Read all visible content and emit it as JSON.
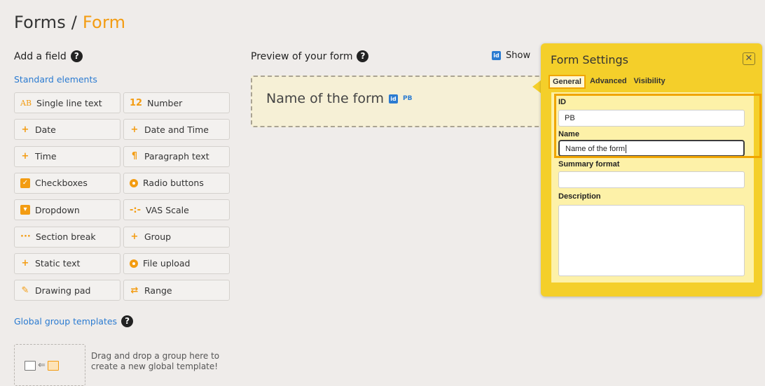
{
  "page": {
    "title_prefix": "Forms / ",
    "title_accent": "Form"
  },
  "left": {
    "add_field": "Add a field",
    "standard": "Standard elements",
    "fields": [
      {
        "label": "Single line text",
        "icon": "ab-icon",
        "glyph": "AB"
      },
      {
        "label": "Number",
        "icon": "number-icon",
        "glyph": "12"
      },
      {
        "label": "Date",
        "icon": "plus-icon",
        "glyph": "+"
      },
      {
        "label": "Date and Time",
        "icon": "plus-icon",
        "glyph": "+"
      },
      {
        "label": "Time",
        "icon": "plus-icon",
        "glyph": "+"
      },
      {
        "label": "Paragraph text",
        "icon": "pilcrow-icon",
        "glyph": "¶"
      },
      {
        "label": "Checkboxes",
        "icon": "checkbox-icon",
        "glyph": "✓"
      },
      {
        "label": "Radio buttons",
        "icon": "radio-icon",
        "glyph": ""
      },
      {
        "label": "Dropdown",
        "icon": "dropdown-icon",
        "glyph": "▾"
      },
      {
        "label": "VAS Scale",
        "icon": "vas-scale-icon",
        "glyph": "-:-"
      },
      {
        "label": "Section break",
        "icon": "ellipsis-icon",
        "glyph": "···"
      },
      {
        "label": "Group",
        "icon": "plus-icon",
        "glyph": "+"
      },
      {
        "label": "Static text",
        "icon": "plus-icon",
        "glyph": "+"
      },
      {
        "label": "File upload",
        "icon": "upload-icon",
        "glyph": ""
      },
      {
        "label": "Drawing pad",
        "icon": "pencil-icon",
        "glyph": "✎"
      },
      {
        "label": "Range",
        "icon": "range-icon",
        "glyph": "⇄"
      }
    ],
    "global_templates": "Global group templates",
    "drop_text_1": "Drag and drop a group here to",
    "drop_text_2": "create a new global template!"
  },
  "preview": {
    "heading": "Preview of your form",
    "show": "Show",
    "form_name": "Name of the form",
    "id_badge": "id",
    "pb": "PB"
  },
  "settings": {
    "title": "Form Settings",
    "tabs": [
      "General",
      "Advanced",
      "Visibility"
    ],
    "id_label": "ID",
    "id_value": "PB",
    "name_label": "Name",
    "name_value": "Name of the form",
    "summary_label": "Summary format",
    "summary_value": "",
    "description_label": "Description"
  },
  "colors": {
    "accent": "#f39c12",
    "link": "#2b7bd1",
    "panel": "#f4cf2a"
  }
}
